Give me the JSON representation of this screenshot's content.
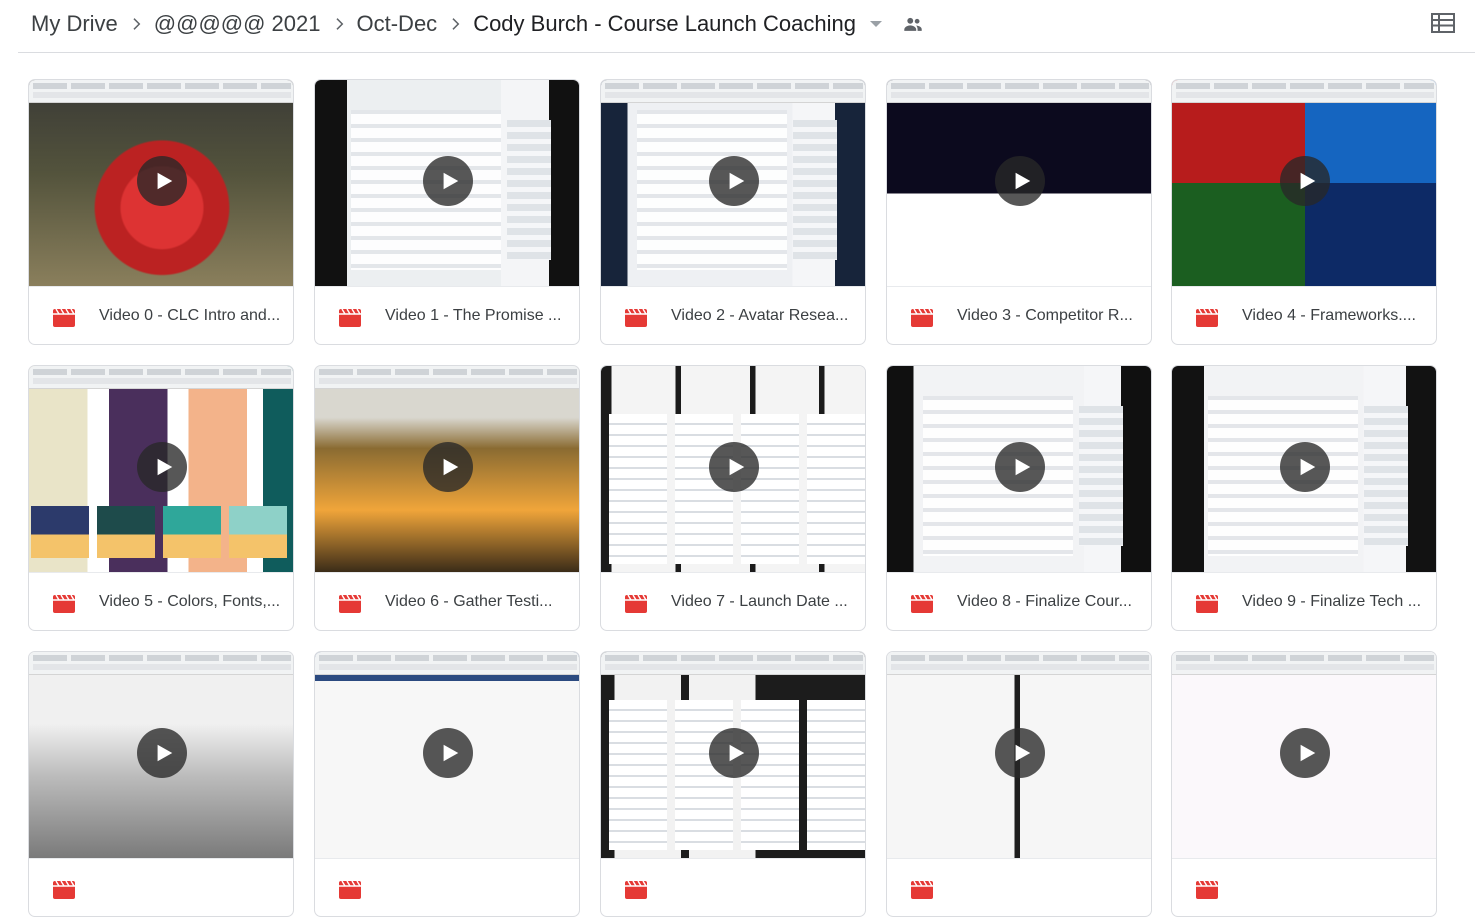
{
  "breadcrumb": {
    "items": [
      "My Drive",
      "@@@@@ 2021",
      "Oct-Dec",
      "Cody Burch - Course Launch Coaching"
    ]
  },
  "icons": {
    "separator": "chevron-right-icon",
    "dropdown": "caret-down-icon",
    "shared": "people-icon",
    "view": "grid-view-icon",
    "file": "video-file-icon",
    "play": "play-icon"
  },
  "colors": {
    "file_icon": "#e53935",
    "text": "#3c4043",
    "border": "#dadce0"
  },
  "files": [
    {
      "title": "Video 0 - CLC Intro and..."
    },
    {
      "title": "Video 1 - The Promise ..."
    },
    {
      "title": "Video 2 - Avatar Resea..."
    },
    {
      "title": "Video 3 - Competitor R..."
    },
    {
      "title": "Video 4 - Frameworks...."
    },
    {
      "title": "Video 5 - Colors, Fonts,..."
    },
    {
      "title": "Video 6 - Gather Testi..."
    },
    {
      "title": "Video 7 - Launch Date ..."
    },
    {
      "title": "Video 8 - Finalize Cour..."
    },
    {
      "title": "Video 9 - Finalize Tech ..."
    },
    {
      "title": ""
    },
    {
      "title": ""
    },
    {
      "title": ""
    },
    {
      "title": ""
    },
    {
      "title": ""
    }
  ]
}
